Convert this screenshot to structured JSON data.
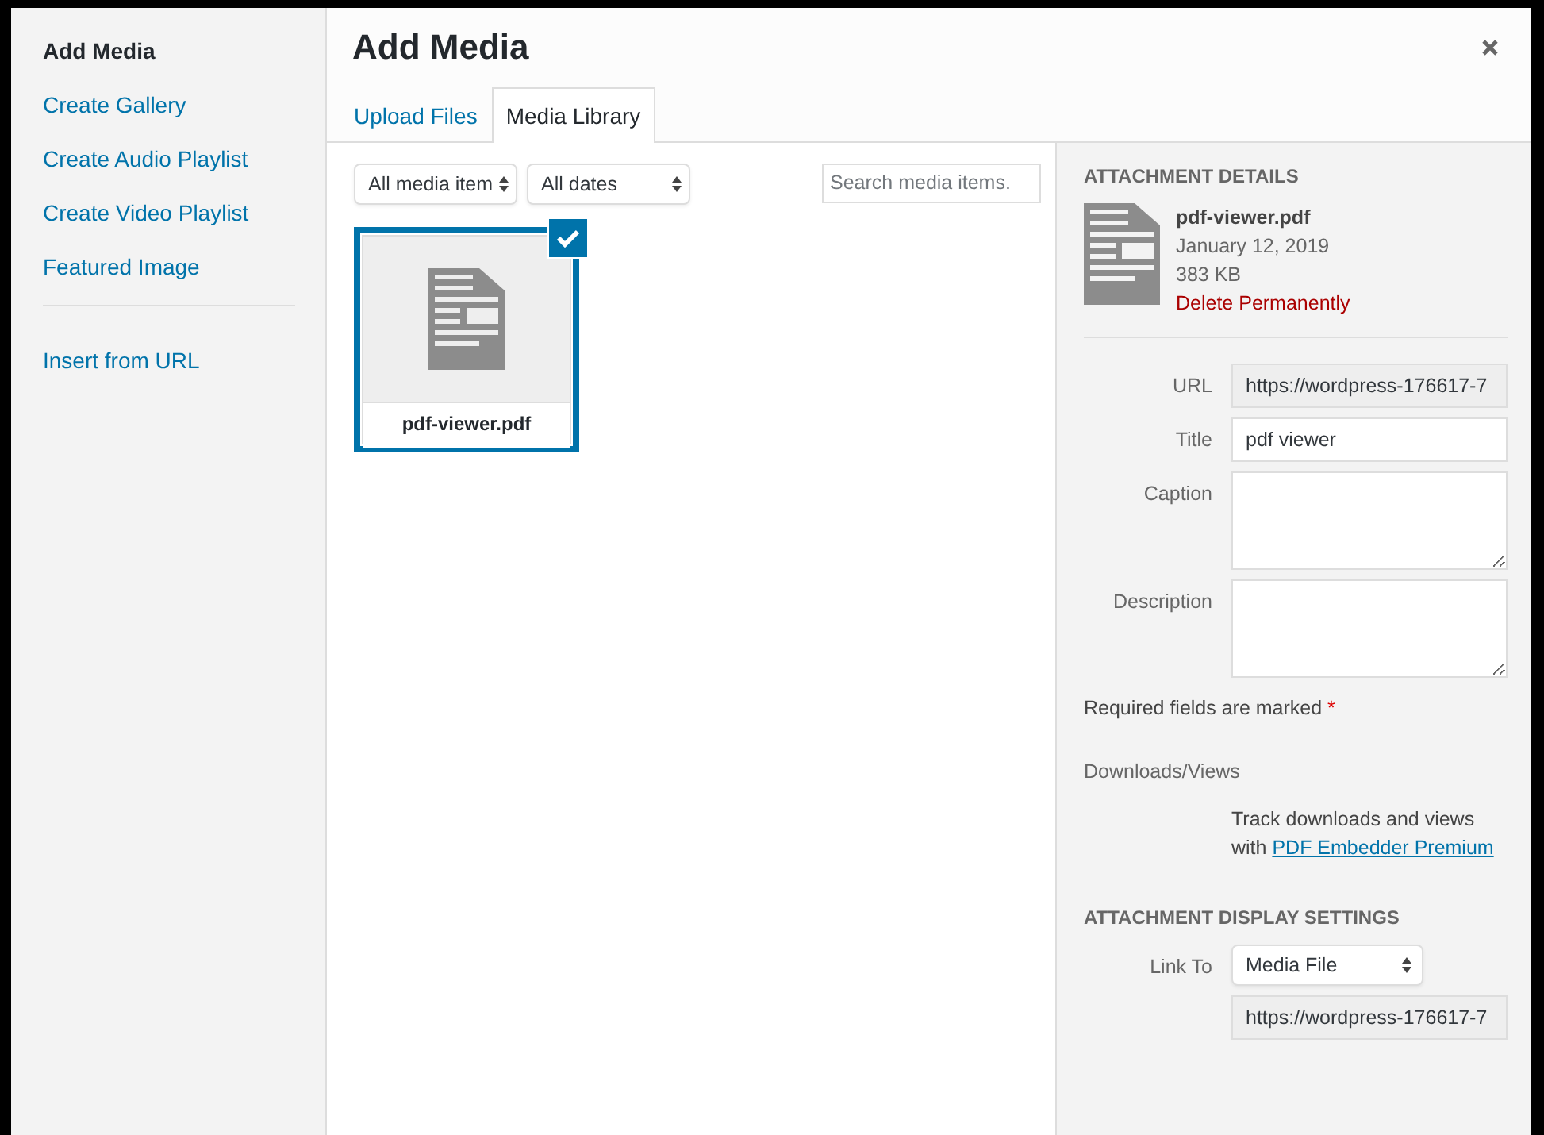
{
  "menu": {
    "items": [
      {
        "label": "Add Media",
        "selected": true
      },
      {
        "label": "Create Gallery",
        "selected": false
      },
      {
        "label": "Create Audio Playlist",
        "selected": false
      },
      {
        "label": "Create Video Playlist",
        "selected": false
      },
      {
        "label": "Featured Image",
        "selected": false
      }
    ],
    "extra_items": [
      {
        "label": "Insert from URL",
        "selected": false
      }
    ]
  },
  "title": "Add Media",
  "tabs": [
    {
      "label": "Upload Files",
      "selected": false
    },
    {
      "label": "Media Library",
      "selected": true
    }
  ],
  "filters": [
    {
      "value": "All media item"
    },
    {
      "value": "All dates"
    }
  ],
  "search": {
    "placeholder": "Search media items."
  },
  "media_items": [
    {
      "filename": "pdf-viewer.pdf",
      "selected": true
    }
  ],
  "details": {
    "heading": "ATTACHMENT DETAILS",
    "filename": "pdf-viewer.pdf",
    "date": "January 12, 2019",
    "size": "383 KB",
    "delete_link": "Delete Permanently"
  },
  "fields": [
    {
      "label": "URL",
      "kind": "readonly",
      "value": "https://wordpress-176617-7"
    },
    {
      "label": "Title",
      "kind": "text",
      "value": "pdf viewer"
    },
    {
      "label": "Caption",
      "kind": "textarea"
    },
    {
      "label": "Description",
      "kind": "textarea"
    }
  ],
  "required_note": {
    "text": "Required fields are marked",
    "mark": "*"
  },
  "downloads": {
    "label": "Downloads/Views",
    "text": "Track downloads and views with",
    "link": "PDF Embedder Premium"
  },
  "display_settings": {
    "heading": "ATTACHMENT DISPLAY SETTINGS",
    "link_to_label": "Link To",
    "link_to_value": "Media File",
    "url_value": "https://wordpress-176617-7"
  }
}
